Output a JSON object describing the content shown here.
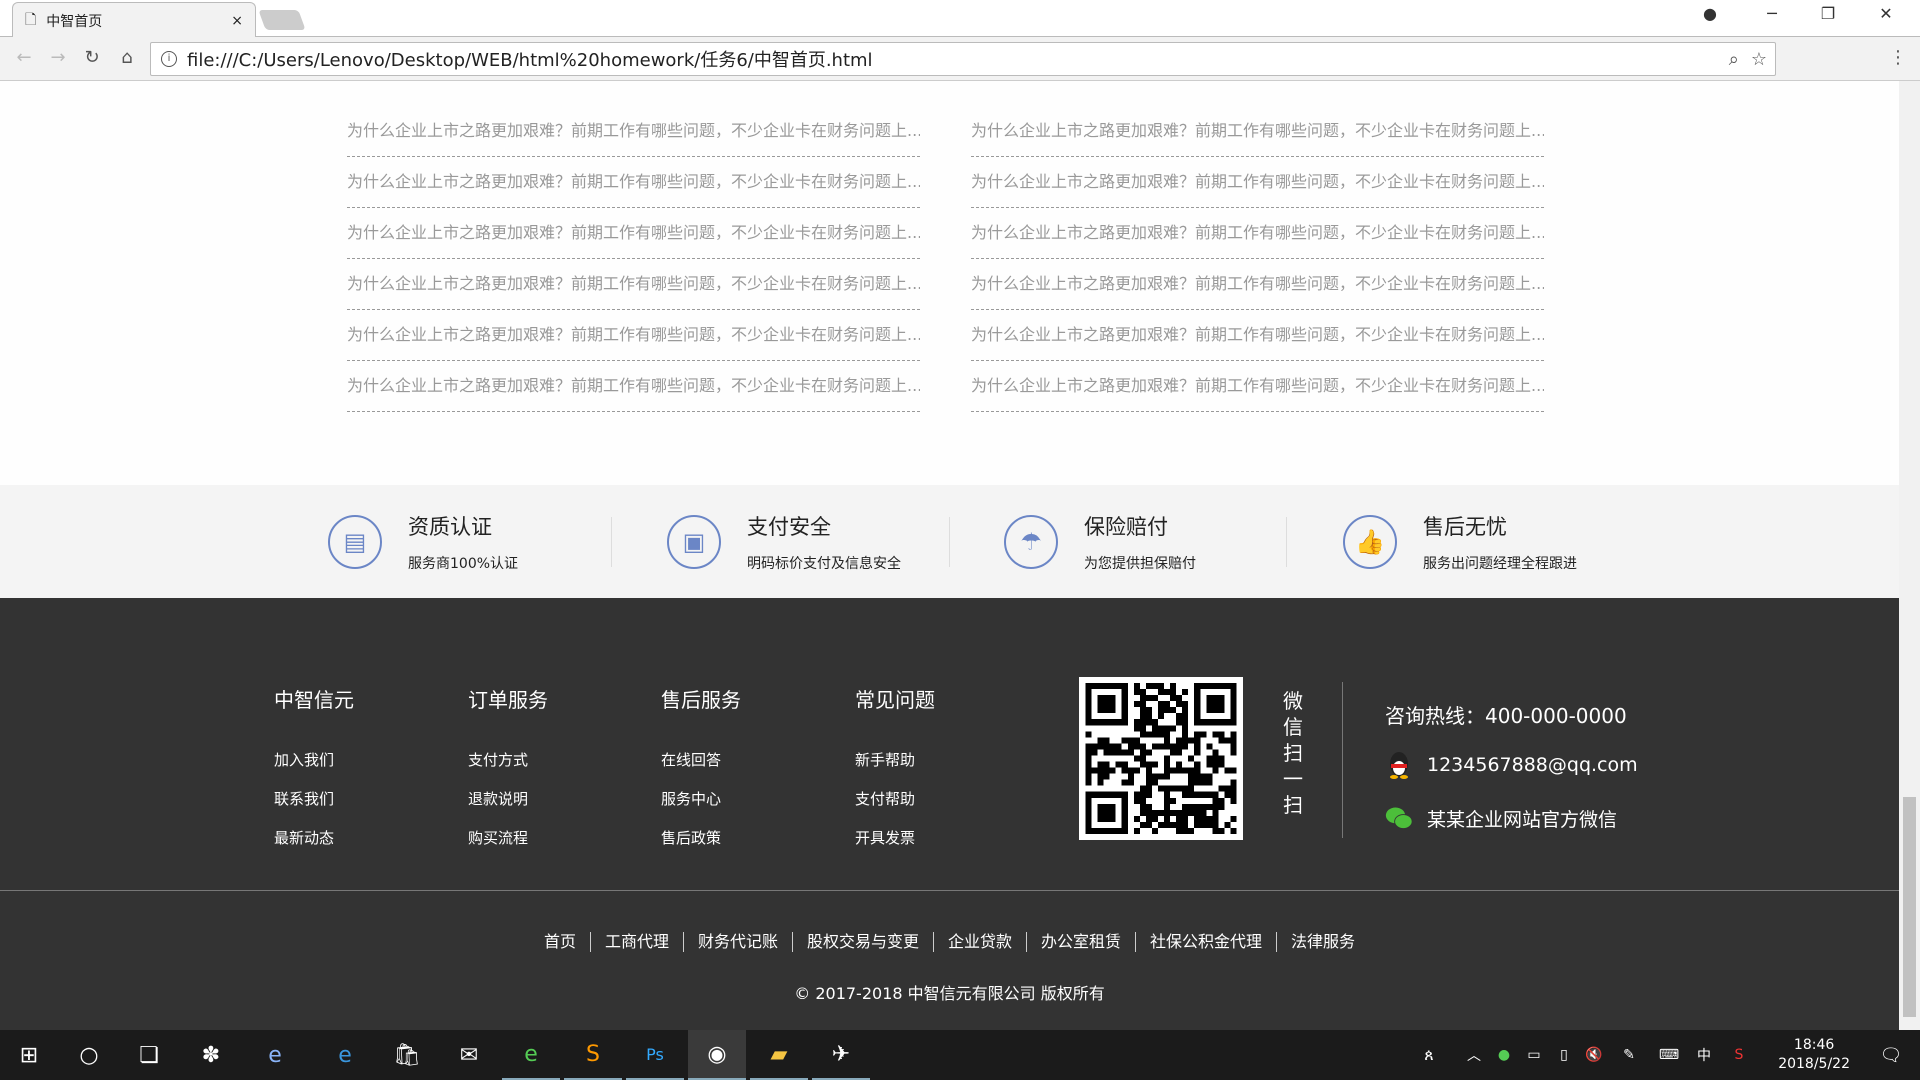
{
  "browser": {
    "tab_title": "中智首页",
    "url": "file:///C:/Users/Lenovo/Desktop/WEB/html%20homework/任务6/中智首页.html"
  },
  "articles": {
    "left": [
      "为什么企业上市之路更加艰难？前期工作有哪些问题，不少企业卡在财务问题上...",
      "为什么企业上市之路更加艰难？前期工作有哪些问题，不少企业卡在财务问题上...",
      "为什么企业上市之路更加艰难？前期工作有哪些问题，不少企业卡在财务问题上...",
      "为什么企业上市之路更加艰难？前期工作有哪些问题，不少企业卡在财务问题上...",
      "为什么企业上市之路更加艰难？前期工作有哪些问题，不少企业卡在财务问题上...",
      "为什么企业上市之路更加艰难？前期工作有哪些问题，不少企业卡在财务问题上..."
    ],
    "right": [
      "为什么企业上市之路更加艰难？前期工作有哪些问题，不少企业卡在财务问题上...",
      "为什么企业上市之路更加艰难？前期工作有哪些问题，不少企业卡在财务问题上...",
      "为什么企业上市之路更加艰难？前期工作有哪些问题，不少企业卡在财务问题上...",
      "为什么企业上市之路更加艰难？前期工作有哪些问题，不少企业卡在财务问题上...",
      "为什么企业上市之路更加艰难？前期工作有哪些问题，不少企业卡在财务问题上...",
      "为什么企业上市之路更加艰难？前期工作有哪些问题，不少企业卡在财务问题上..."
    ]
  },
  "features": [
    {
      "title": "资质认证",
      "sub": "服务商100%认证",
      "icon": "certificate-icon"
    },
    {
      "title": "支付安全",
      "sub": "明码标价支付及信息安全",
      "icon": "wallet-icon"
    },
    {
      "title": "保险赔付",
      "sub": "为您提供担保赔付",
      "icon": "umbrella-icon"
    },
    {
      "title": "售后无忧",
      "sub": "服务出问题经理全程跟进",
      "icon": "thumbs-up-icon"
    }
  ],
  "footer": {
    "columns": [
      {
        "title": "中智信元",
        "links": [
          "加入我们",
          "联系我们",
          "最新动态"
        ]
      },
      {
        "title": "订单服务",
        "links": [
          "支付方式",
          "退款说明",
          "购买流程"
        ]
      },
      {
        "title": "售后服务",
        "links": [
          "在线回答",
          "服务中心",
          "售后政策"
        ]
      },
      {
        "title": "常见问题",
        "links": [
          "新手帮助",
          "支付帮助",
          "开具发票"
        ]
      }
    ],
    "scan_text": "微信扫一扫",
    "hotline": "咨询热线：400-000-0000",
    "qq": "1234567888@qq.com",
    "wechat": "某某企业网站官方微信",
    "nav": [
      "首页",
      "工商代理",
      "财务代记账",
      "股权交易与变更",
      "企业贷款",
      "办公室租赁",
      "社保公积金代理",
      "法律服务"
    ],
    "copyright": "© 2017-2018 中智信元有限公司 版权所有"
  },
  "taskbar": {
    "time": "18:46",
    "date": "2018/5/22",
    "ime": "中"
  },
  "colors": {
    "footer_bg": "#333333",
    "accent_icon": "#6b86c6",
    "feature_bg": "#f4f4f4"
  }
}
